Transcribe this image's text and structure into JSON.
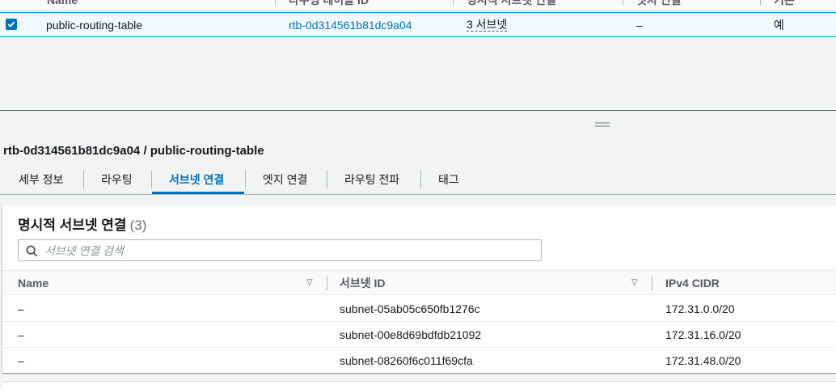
{
  "top_table": {
    "headers": {
      "name": "Name",
      "route_table_id": "라우팅 테이블 ID",
      "explicit_subnet": "명시적 서브넷 연결",
      "edge": "엣지 연결",
      "main": "기본"
    },
    "row": {
      "selected": true,
      "name": "public-routing-table",
      "route_table_id": "rtb-0d314561b81dc9a04",
      "explicit_subnet": "3 서브넷",
      "edge": "–",
      "main": "예"
    }
  },
  "detail": {
    "title": "rtb-0d314561b81dc9a04 / public-routing-table",
    "tabs": [
      "세부 정보",
      "라우팅",
      "서브넷 연결",
      "엣지 연결",
      "라우팅 전파",
      "태그"
    ],
    "active_tab": "서브넷 연결"
  },
  "subnets": {
    "title": "명시적 서브넷 연결",
    "count": "(3)",
    "search_placeholder": "서브넷 연결 검색",
    "columns": [
      "Name",
      "서브넷 ID",
      "IPv4 CIDR"
    ],
    "rows": [
      {
        "name": "–",
        "subnet_id": "subnet-05ab05c650fb1276c",
        "cidr": "172.31.0.0/20"
      },
      {
        "name": "–",
        "subnet_id": "subnet-00e8d69bdfdb21092",
        "cidr": "172.31.16.0/20"
      },
      {
        "name": "–",
        "subnet_id": "subnet-08260f6c011f69cfa",
        "cidr": "172.31.48.0/20"
      }
    ]
  },
  "colors": {
    "link": "#0073bb",
    "selected_row_bg": "#f1faff",
    "selected_row_border": "#00a1c9"
  },
  "icons": {
    "checkbox": "checkbox-checked-icon",
    "search": "search-icon",
    "sort": "sort-down-caret-icon",
    "resize": "drag-handle-icon"
  }
}
